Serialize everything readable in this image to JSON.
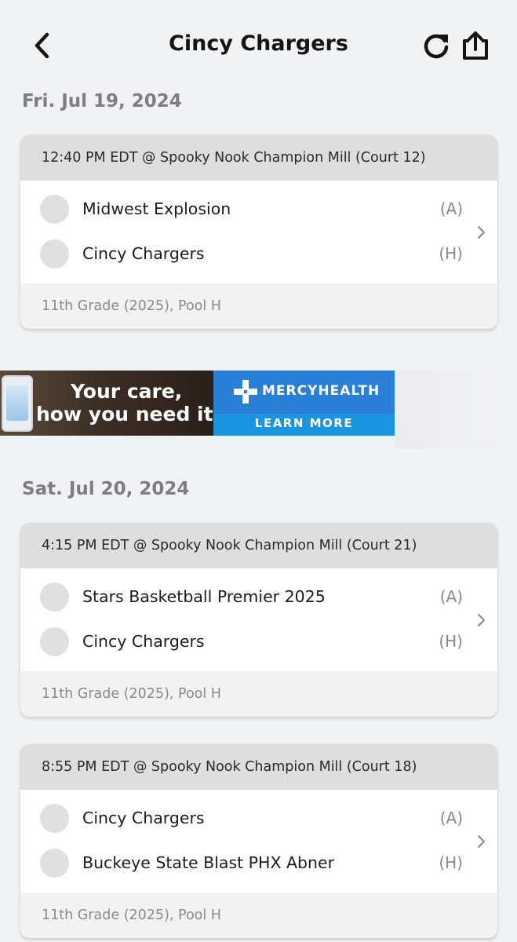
{
  "header": {
    "title": "Cincy Chargers"
  },
  "dates": [
    "Fri. Jul 19, 2024",
    "Sat. Jul 20, 2024"
  ],
  "games": [
    {
      "time_location": "12:40 PM EDT @ Spooky Nook Champion Mill (Court 12)",
      "teams": [
        {
          "name": "Midwest Explosion",
          "side": "(A)"
        },
        {
          "name": "Cincy Chargers",
          "side": "(H)"
        }
      ],
      "division": "11th Grade (2025), Pool H"
    },
    {
      "time_location": "4:15 PM EDT @ Spooky Nook Champion Mill (Court 21)",
      "teams": [
        {
          "name": "Stars Basketball Premier 2025",
          "side": "(A)"
        },
        {
          "name": "Cincy Chargers",
          "side": "(H)"
        }
      ],
      "division": "11th Grade (2025), Pool H"
    },
    {
      "time_location": "8:55 PM EDT @ Spooky Nook Champion Mill (Court 18)",
      "teams": [
        {
          "name": "Cincy Chargers",
          "side": "(A)"
        },
        {
          "name": "Buckeye State Blast PHX Abner",
          "side": "(H)"
        }
      ],
      "division": "11th Grade (2025), Pool H"
    }
  ],
  "ad": {
    "headline_line1": "Your care,",
    "headline_line2": "how you need it.",
    "brand": "MERCYHEALTH",
    "cta": "LEARN MORE",
    "colors": {
      "brand_blue": "#2a7fd6",
      "cta_blue": "#1b95e0"
    }
  },
  "icons": {
    "back": "chevron-left-icon",
    "refresh": "refresh-icon",
    "share": "share-icon",
    "row_chevron": "chevron-right-icon"
  }
}
